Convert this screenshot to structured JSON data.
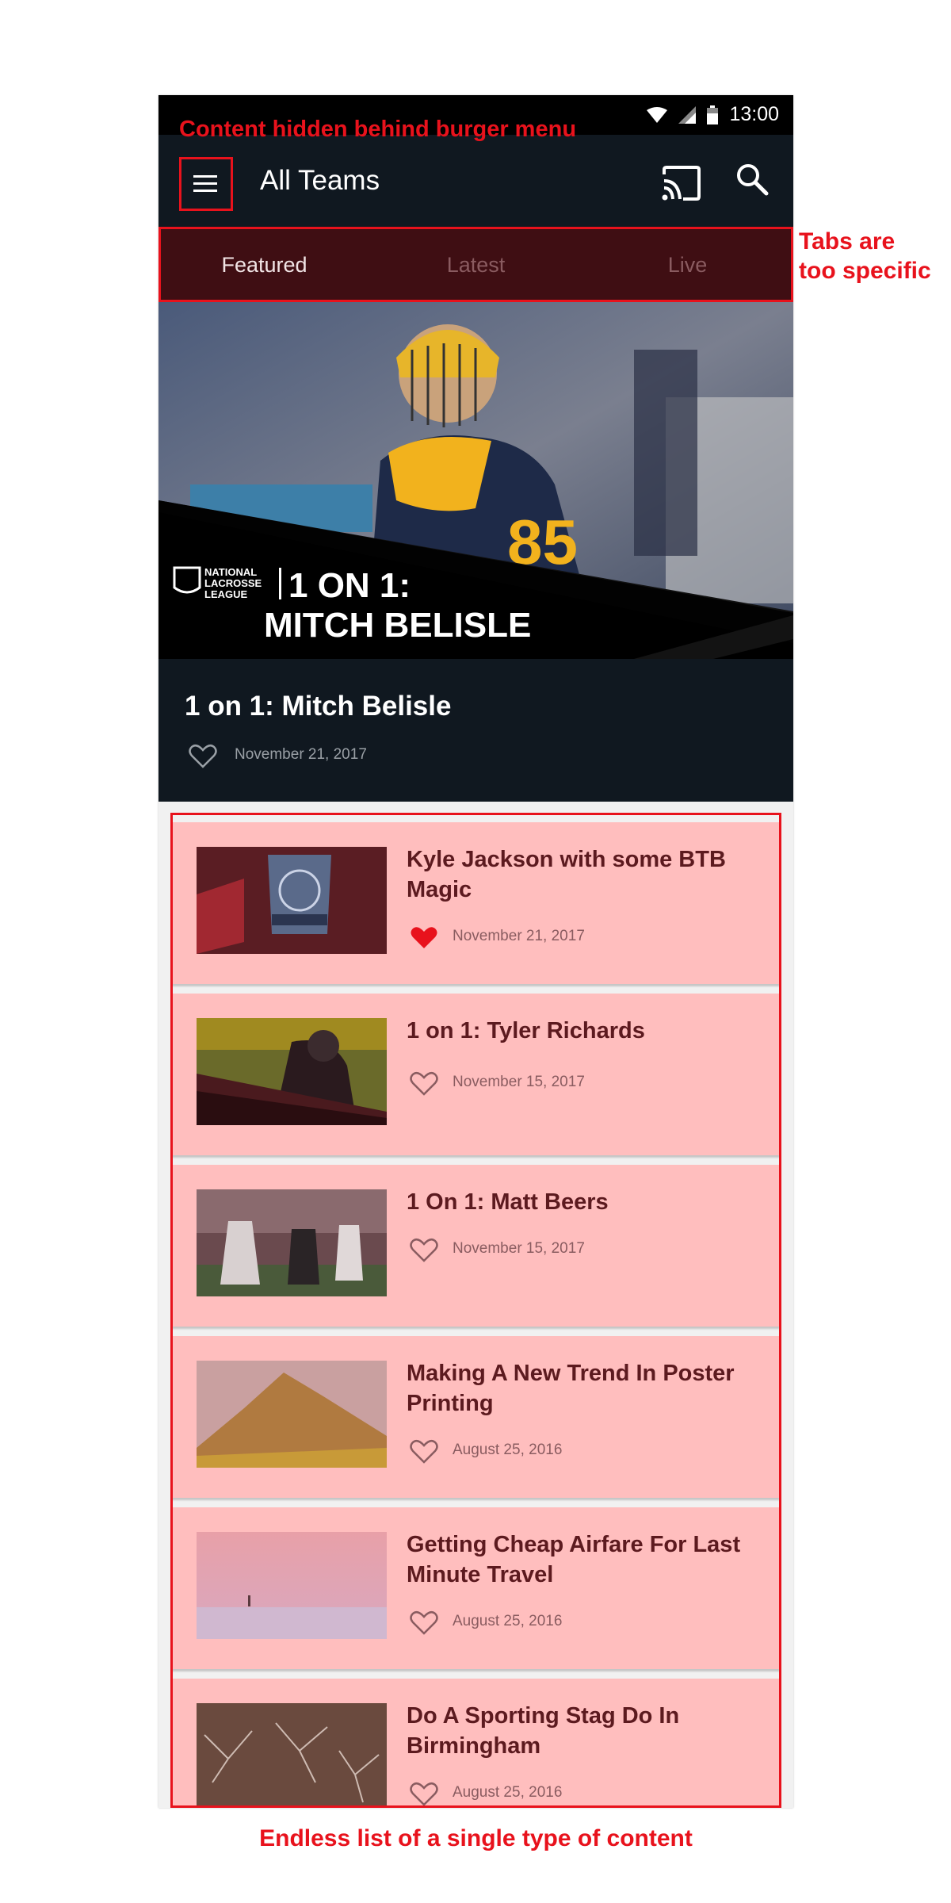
{
  "status_bar": {
    "time": "13:00"
  },
  "app_bar": {
    "title": "All Teams"
  },
  "tabs": [
    {
      "label": "Featured",
      "active": true
    },
    {
      "label": "Latest",
      "active": false
    },
    {
      "label": "Live",
      "active": false
    }
  ],
  "hero": {
    "graphic_line1": "1 ON 1:",
    "graphic_line2": "MITCH BELISLE",
    "league_logo": "NATIONAL LACROSSE LEAGUE",
    "title": "1 on 1: Mitch Belisle",
    "date": "November 21, 2017",
    "liked": false
  },
  "list_items": [
    {
      "title": "Kyle Jackson with some BTB Magic",
      "date": "November 21, 2017",
      "liked": true
    },
    {
      "title": "1 on 1: Tyler Richards",
      "date": "November 15, 2017",
      "liked": false
    },
    {
      "title": "1 On 1: Matt Beers",
      "date": "November 15, 2017",
      "liked": false
    },
    {
      "title": "Making A New Trend In Poster Printing",
      "date": "August 25, 2016",
      "liked": false
    },
    {
      "title": "Getting Cheap Airfare For Last Minute Travel",
      "date": "August 25, 2016",
      "liked": false
    },
    {
      "title": "Do A Sporting Stag Do In Birmingham",
      "date": "August 25, 2016",
      "liked": false
    }
  ],
  "annotations": {
    "burger": "Content hidden behind burger menu",
    "tabs_line1": "Tabs are",
    "tabs_line2": "too specific",
    "list": "Endless list of a single type of content"
  },
  "colors": {
    "annotation_red": "#e8121c",
    "app_bar": "#101820",
    "tab_bar": "#3f0e13",
    "card_highlight": "#ffbebe",
    "liked_heart": "#e8121c"
  }
}
